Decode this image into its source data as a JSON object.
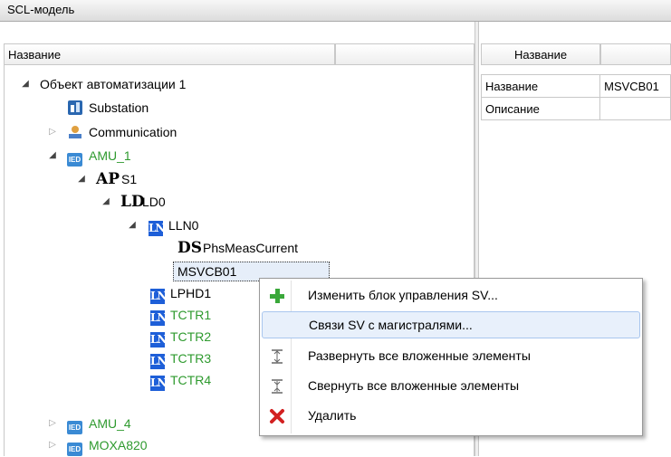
{
  "window": {
    "title": "SCL-модель"
  },
  "tree": {
    "header": "Название",
    "root": "Объект автоматизации 1",
    "substation": "Substation",
    "communication": "Communication",
    "ied1": "AMU_1",
    "ap": "S1",
    "ld": "LD0",
    "lln0": "LLN0",
    "dataset": "PhsMeasCurrent",
    "sv_block": "MSVCB01",
    "ln_items": [
      "LPHD1",
      "TCTR1",
      "TCTR2",
      "TCTR3",
      "TCTR4"
    ],
    "ied2": "AMU_4",
    "ied3": "MOXA820",
    "icons": {
      "ap": "AP",
      "ld": "LD",
      "ds": "DS",
      "ln": "LN",
      "ied": "IED"
    }
  },
  "properties": {
    "header": "Название",
    "rows": [
      {
        "name": "Название",
        "value": "MSVCB01"
      },
      {
        "name": "Описание",
        "value": ""
      }
    ]
  },
  "context_menu": {
    "items": [
      {
        "label": "Изменить блок управления SV...",
        "icon": "plus-icon"
      },
      {
        "label": "Связи SV с магистралями...",
        "icon": "none"
      },
      {
        "label": "Развернуть все вложенные элементы",
        "icon": "expand-all-icon"
      },
      {
        "label": "Свернуть все вложенные элементы",
        "icon": "collapse-all-icon"
      },
      {
        "label": "Удалить",
        "icon": "delete-icon"
      }
    ]
  },
  "colors": {
    "green_text": "#2e9a2e",
    "ln_blue": "#1e5fd8",
    "delete_red": "#d22020",
    "plus_green": "#3aa83a"
  }
}
